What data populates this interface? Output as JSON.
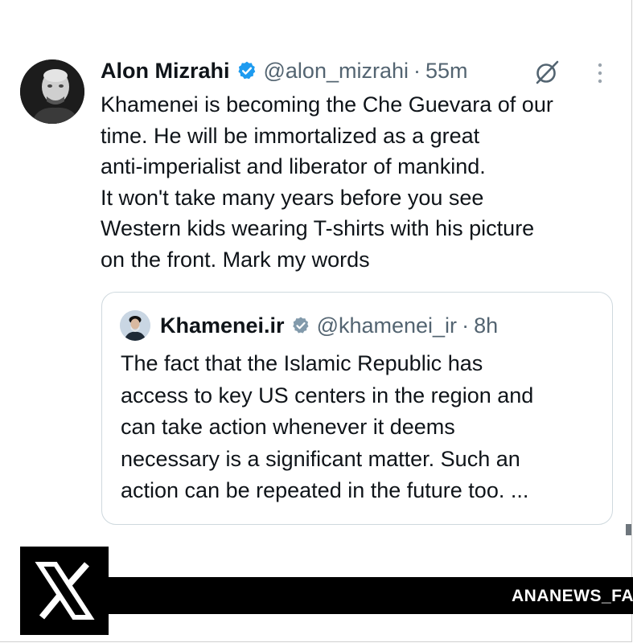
{
  "tweet": {
    "author_name": "Alon Mizrahi",
    "handle": "@alon_mizrahi",
    "separator": "·",
    "time": "55m",
    "lines": [
      "Khamenei is becoming the Che Guevara of our",
      "time. He will be immortalized as a great",
      "anti-imperialist and liberator of mankind.",
      "It won't take many years before you see",
      "Western kids wearing T-shirts with his picture",
      "on the front. Mark my words"
    ]
  },
  "quoted_tweet": {
    "author_name": "Khamenei.ir",
    "handle": "@khamenei_ir",
    "separator": "·",
    "time": "8h",
    "lines": [
      "The fact that the Islamic Republic has",
      "access to key US centers in the region and",
      "can take action whenever it deems",
      "necessary is a significant matter. Such an",
      "action can be repeated in the future too. ..."
    ]
  },
  "watermark": "ANANEWS_FA",
  "icons": {
    "verified": "verified-badge-icon",
    "grok": "grok-icon",
    "more": "more-vertical-icon",
    "x_logo": "x-logo-icon"
  },
  "colors": {
    "verified_blue": "#1d9bf0",
    "quoted_verified_gray": "#829aab",
    "text": "#0f1419",
    "secondary_text": "#536471",
    "border": "#cfd9de",
    "black": "#000000"
  }
}
